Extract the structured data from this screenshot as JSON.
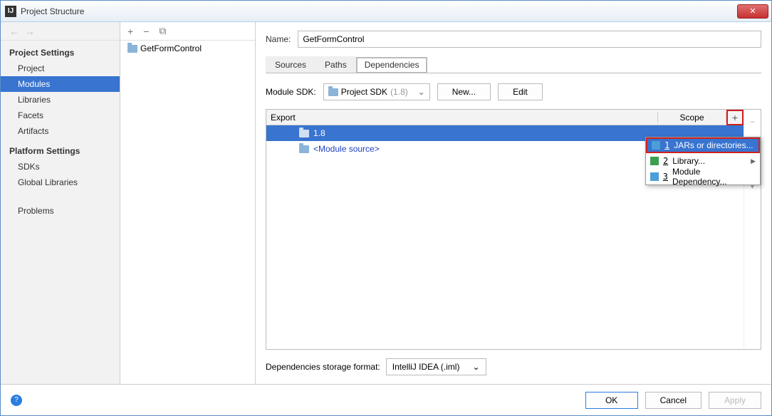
{
  "window": {
    "title": "Project Structure"
  },
  "sidebar": {
    "groups": [
      {
        "title": "Project Settings",
        "items": [
          "Project",
          "Modules",
          "Libraries",
          "Facets",
          "Artifacts"
        ],
        "selected": 1
      },
      {
        "title": "Platform Settings",
        "items": [
          "SDKs",
          "Global Libraries"
        ]
      },
      {
        "title": "",
        "items": [
          "Problems"
        ]
      }
    ]
  },
  "tree": {
    "module": "GetFormControl"
  },
  "main": {
    "name_label": "Name:",
    "name_value": "GetFormControl",
    "tabs": [
      "Sources",
      "Paths",
      "Dependencies"
    ],
    "active_tab": 2,
    "sdk_label": "Module SDK:",
    "sdk_value": "Project SDK",
    "sdk_hint": "(1.8)",
    "new_btn": "New...",
    "edit_btn": "Edit",
    "table": {
      "col_export": "Export",
      "col_scope": "Scope",
      "rows": [
        {
          "text": "1.8",
          "selected": true
        },
        {
          "text": "<Module source>",
          "source": true
        }
      ]
    },
    "popup": [
      {
        "num": "1",
        "label": "JARs or directories...",
        "hl": true,
        "color": "#4a9fd8"
      },
      {
        "num": "2",
        "label": "Library...",
        "arrow": true,
        "color": "#3aa050"
      },
      {
        "num": "3",
        "label": "Module Dependency...",
        "color": "#4a9fd8"
      }
    ],
    "storage_label": "Dependencies storage format:",
    "storage_value": "IntelliJ IDEA (.iml)"
  },
  "footer": {
    "ok": "OK",
    "cancel": "Cancel",
    "apply": "Apply"
  }
}
